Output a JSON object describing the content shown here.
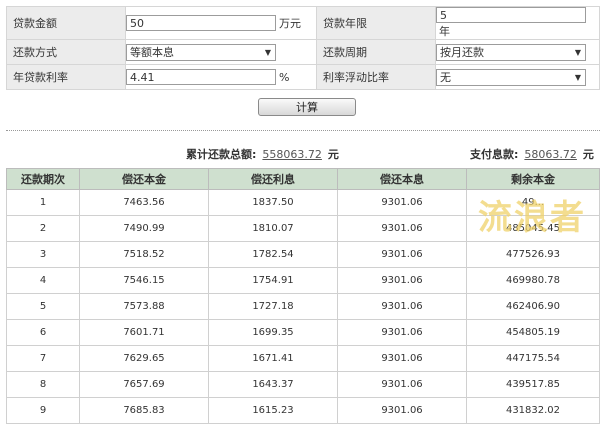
{
  "form": {
    "loan_amount_label": "贷款金额",
    "loan_amount_value": "50",
    "loan_amount_unit": "万元",
    "loan_term_label": "贷款年限",
    "loan_term_value": "5",
    "loan_term_unit": "年",
    "repayment_method_label": "还款方式",
    "repayment_method_value": "等额本息",
    "repayment_cycle_label": "还款周期",
    "repayment_cycle_value": "按月还款",
    "annual_rate_label": "年贷款利率",
    "annual_rate_value": "4.41",
    "annual_rate_unit": "%",
    "rate_float_label": "利率浮动比率",
    "rate_float_value": "无",
    "calculate_label": "计算"
  },
  "summary": {
    "total_label": "累计还款总额:",
    "total_value": "558063.72",
    "total_unit": "元",
    "interest_label": "支付息款:",
    "interest_value": "58063.72",
    "interest_unit": "元"
  },
  "table": {
    "headers": [
      "还款期次",
      "偿还本金",
      "偿还利息",
      "偿还本息",
      "剩余本金"
    ],
    "rows": [
      [
        "1",
        "7463.56",
        "1837.50",
        "9301.06",
        "49..."
      ],
      [
        "2",
        "7490.99",
        "1810.07",
        "9301.06",
        "485045.45"
      ],
      [
        "3",
        "7518.52",
        "1782.54",
        "9301.06",
        "477526.93"
      ],
      [
        "4",
        "7546.15",
        "1754.91",
        "9301.06",
        "469980.78"
      ],
      [
        "5",
        "7573.88",
        "1727.18",
        "9301.06",
        "462406.90"
      ],
      [
        "6",
        "7601.71",
        "1699.35",
        "9301.06",
        "454805.19"
      ],
      [
        "7",
        "7629.65",
        "1671.41",
        "9301.06",
        "447175.54"
      ],
      [
        "8",
        "7657.69",
        "1643.37",
        "9301.06",
        "439517.85"
      ],
      [
        "9",
        "7685.83",
        "1615.23",
        "9301.06",
        "431832.02"
      ]
    ]
  },
  "watermark": {
    "text": "流浪者",
    "color": "#f0d26a"
  }
}
